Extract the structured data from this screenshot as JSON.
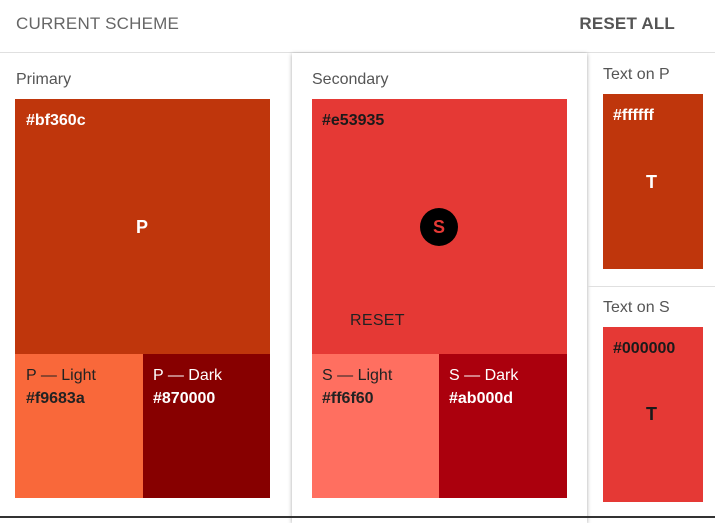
{
  "header": {
    "title": "CURRENT SCHEME",
    "reset_all": "RESET ALL"
  },
  "primary": {
    "label": "Primary",
    "hex": "#bf360c",
    "letter": "P",
    "light": {
      "label": "P — Light",
      "hex": "#f9683a"
    },
    "dark": {
      "label": "P — Dark",
      "hex": "#870000"
    }
  },
  "secondary": {
    "label": "Secondary",
    "hex": "#e53935",
    "badge": "S",
    "reset": "RESET",
    "light": {
      "label": "S — Light",
      "hex": "#ff6f60"
    },
    "dark": {
      "label": "S — Dark",
      "hex": "#ab000d"
    }
  },
  "text_on_p": {
    "label": "Text on P",
    "hex": "#ffffff",
    "letter": "T",
    "bg": "#bf360c"
  },
  "text_on_s": {
    "label": "Text on S",
    "hex": "#000000",
    "letter": "T",
    "bg": "#e53935"
  }
}
